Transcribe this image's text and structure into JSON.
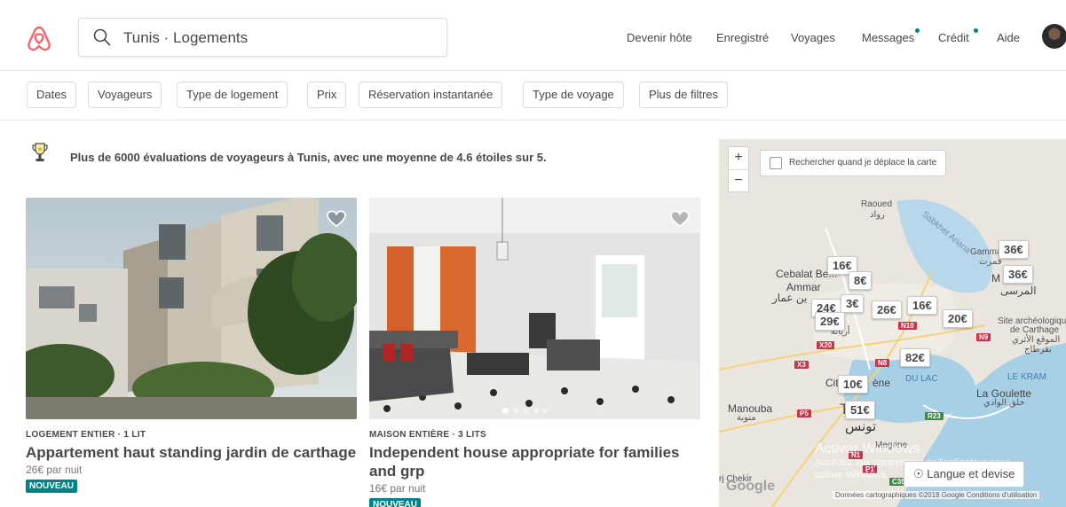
{
  "header": {
    "search_value": "Tunis · Logements",
    "nav": [
      "Devenir hôte",
      "Enregistré",
      "Voyages",
      "Messages",
      "Crédit",
      "Aide"
    ]
  },
  "filters": [
    "Dates",
    "Voyageurs",
    "Type de logement",
    "Prix",
    "Réservation instantanée",
    "Type de voyage",
    "Plus de filtres"
  ],
  "banner": "Plus de 6000 évaluations de voyageurs à Tunis, avec une moyenne de 4.6 étoiles sur 5.",
  "listings": [
    {
      "type": "LOGEMENT ENTIER · 1 LIT",
      "title": "Appartement haut standing jardin de carthage",
      "price": "26€ par nuit",
      "badge": "NOUVEAU"
    },
    {
      "type": "MAISON ENTIÈRE · 3 LITS",
      "title": "Independent house appropriate for families and grp",
      "price": "16€ par nuit",
      "badge": "NOUVEAU"
    }
  ],
  "map": {
    "zoom_in": "+",
    "zoom_out": "−",
    "search_toggle": "Rechercher quand je déplace la carte",
    "prices": [
      "36€",
      "36€",
      "16€",
      "8€",
      "24€",
      "3€",
      "26€",
      "16€",
      "20€",
      "29€",
      "82€",
      "10€",
      "51€"
    ],
    "labels": [
      "Raoued",
      "رواد",
      "Sabkhet Ariana",
      "Gammarth",
      "قمرت",
      "M",
      "المرسى",
      "Cebalat Be...",
      "Ammar",
      "ين عمار",
      "أريانة",
      "Site archéologique",
      "de Carthage",
      "الموقع الأثري",
      "بقرطاج",
      "LE KRAM",
      "La Goulette",
      "حلق الوادي",
      "DU LAC",
      "Cit",
      "ène",
      "Manouba",
      "منوبة",
      "T",
      "تونس",
      "Megrine",
      "rj Chekir"
    ],
    "roads": [
      "N10",
      "N9",
      "X20",
      "N8",
      "X3",
      "P5",
      "R23",
      "N1",
      "P1",
      "C35"
    ],
    "lang_button": "Langue et devise",
    "google": "Google",
    "footer": "Données cartographiques ©2018 Google   Conditions d'utilisation",
    "watermark": [
      "Activer Windows",
      "Accédez aux paramètres de l'ordinateur pour",
      "activer Windows."
    ]
  },
  "colors": {
    "brand": "#FF5A5F",
    "teal": "#008489",
    "road_red": "#c8354b",
    "road_green": "#3f8a4a"
  }
}
